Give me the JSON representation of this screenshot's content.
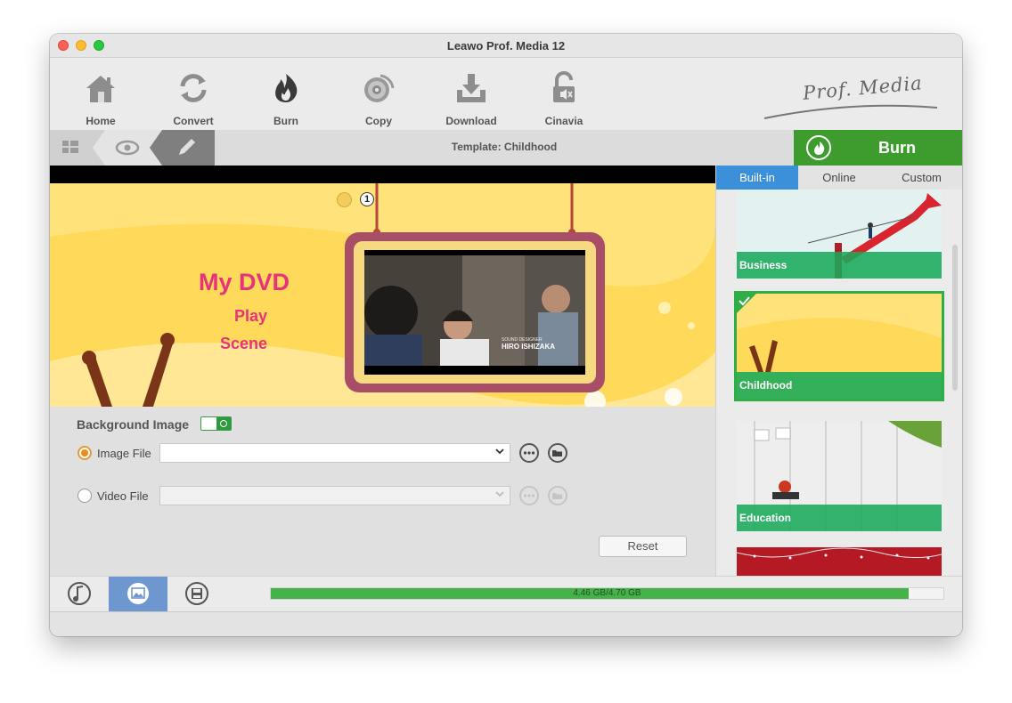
{
  "window": {
    "title": "Leawo Prof. Media 12"
  },
  "toolbar": {
    "items": [
      {
        "label": "Home",
        "icon": "home-icon"
      },
      {
        "label": "Convert",
        "icon": "convert-icon"
      },
      {
        "label": "Burn",
        "icon": "burn-icon"
      },
      {
        "label": "Copy",
        "icon": "copy-icon"
      },
      {
        "label": "Download",
        "icon": "download-icon"
      },
      {
        "label": "Cinavia",
        "icon": "cinavia-icon"
      }
    ],
    "logo": "Prof. Media"
  },
  "subbar": {
    "template_title": "Template: Childhood",
    "burn_label": "Burn"
  },
  "preview": {
    "title": "My DVD",
    "play": "Play",
    "scene": "Scene",
    "page_number": "1",
    "photo_caption_small": "SOUND DESIGNER",
    "photo_caption": "HIRO ISHIZAKA"
  },
  "settings": {
    "background_label": "Background Image",
    "background_enabled": true,
    "image_file_label": "Image File",
    "image_file_value": "",
    "video_file_label": "Video File",
    "video_file_value": "",
    "selected_source": "image",
    "reset_label": "Reset"
  },
  "sidebar": {
    "tabs": [
      {
        "label": "Built-in",
        "active": true
      },
      {
        "label": "Online",
        "active": false
      },
      {
        "label": "Custom",
        "active": false
      }
    ],
    "templates": [
      {
        "label": "Business",
        "selected": false
      },
      {
        "label": "Childhood",
        "selected": true
      },
      {
        "label": "Education",
        "selected": false
      },
      {
        "label": "",
        "selected": false
      }
    ]
  },
  "bottombar": {
    "icons": [
      "music-icon",
      "image-icon",
      "save-icon"
    ],
    "active_icon": "image-icon",
    "disc_usage_text": "4.46 GB/4.70 GB",
    "disc_used_gb": 4.46,
    "disc_capacity_gb": 4.7
  },
  "colors": {
    "burn_green": "#3e9b2d",
    "tab_blue": "#3c8fd9",
    "dvd_pink": "#e6337a",
    "progress_green": "#45b24a",
    "template_label_green": "#19aa5a"
  }
}
